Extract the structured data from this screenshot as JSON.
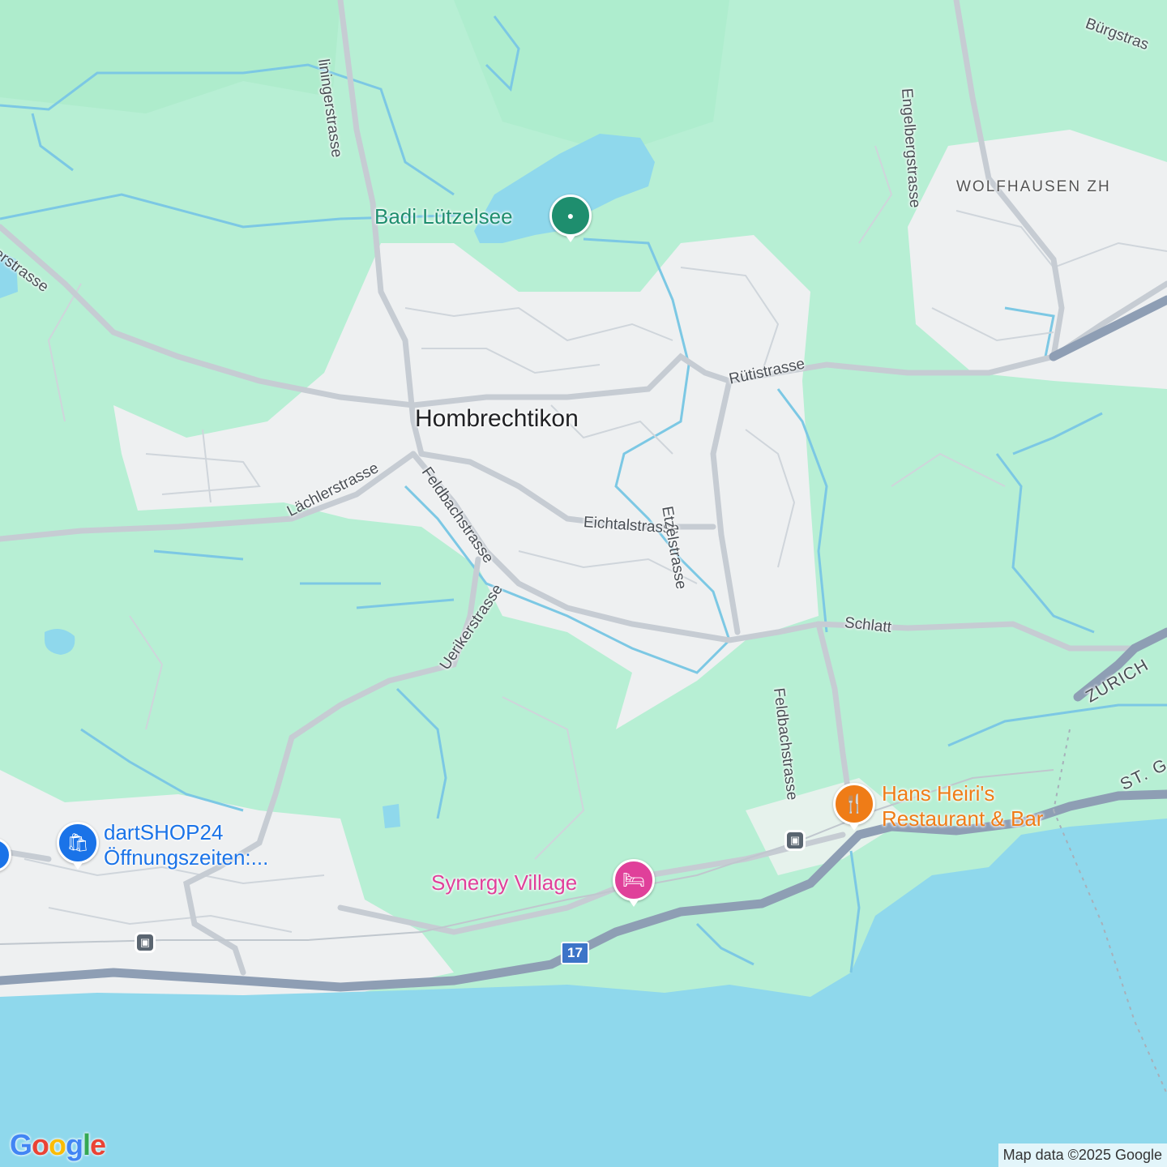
{
  "map": {
    "colors": {
      "land": "#b7efd4",
      "water": "#8fd8ec",
      "urban": "#eef0f1",
      "road": "#c6ccd3",
      "highway": "#8e9eb4",
      "stream": "#7cc8e4"
    },
    "town_label": "Hombrechtikon",
    "locality_label": "WOLFHAUSEN ZH",
    "streets": {
      "holzhausen": "liningerstrasse",
      "leftTop": "erstrasse",
      "engelberg": "Engelbergstrasse",
      "burg": "Bürgstras",
      "ruti": "Rütistrasse",
      "lachler": "Lächlerstrasse",
      "feldbach1": "Feldbachstrasse",
      "eichtal": "Eichtalstrasse",
      "etzel": "Etzelstrasse",
      "ueriker": "Uerikerstrasse",
      "schlatt": "Schlatt",
      "feldbach2": "Feldbachstrasse",
      "zurich": "ZURICH",
      "stg": "ST. G"
    },
    "pois": {
      "badi": {
        "name": "Badi Lützelsee",
        "icon": "park-pin-icon",
        "color": "#1e8e6e"
      },
      "dart": {
        "name_line1": "dartSHOP24",
        "name_line2": "Öffnungszeiten:...",
        "icon": "shopping-bag-pin-icon",
        "color": "#1a73e8"
      },
      "synergy": {
        "name": "Synergy Village",
        "icon": "hotel-bed-pin-icon",
        "color": "#e0409a"
      },
      "hans": {
        "name_line1": "Hans Heiri's",
        "name_line2": "Restaurant & Bar",
        "icon": "restaurant-fork-knife-pin-icon",
        "color": "#ef7c17"
      }
    },
    "route_shield": "17",
    "attribution": "Map data ©2025 Google",
    "logo": "Google"
  }
}
